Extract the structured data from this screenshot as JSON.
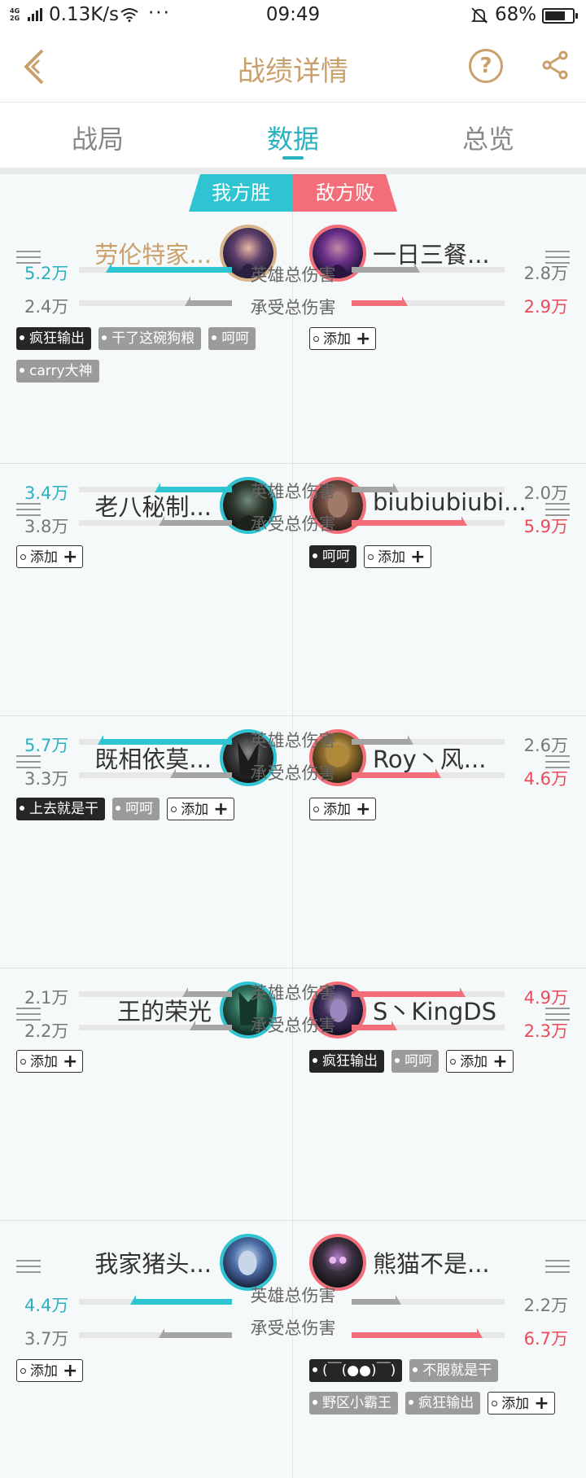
{
  "status": {
    "net": "4G\n2G",
    "speed": "0.13K/s",
    "dots": "···",
    "time": "09:49",
    "battery": "68%"
  },
  "header": {
    "title": "战绩详情",
    "help": "?"
  },
  "tabs": [
    {
      "label": "战局"
    },
    {
      "label": "数据"
    },
    {
      "label": "总览"
    }
  ],
  "result": {
    "us": "我方胜",
    "them": "敌方败"
  },
  "stat_labels": {
    "hero_damage": "英雄总伤害",
    "damage_taken": "承受总伤害"
  },
  "add_label": "添加",
  "rows": [
    {
      "left": {
        "name": "劳伦特家...",
        "hero_damage": "5.2万",
        "damage_taken": "2.4万",
        "tags": [
          "疯狂输出",
          "干了这碗狗粮",
          "呵呵",
          "carry大神"
        ]
      },
      "right": {
        "name": "一日三餐...",
        "hero_damage": "2.8万",
        "damage_taken": "2.9万",
        "tags": []
      }
    },
    {
      "left": {
        "name": "老八秘制...",
        "hero_damage": "3.4万",
        "damage_taken": "3.8万",
        "tags": []
      },
      "right": {
        "name": "biubiubiubi...",
        "hero_damage": "2.0万",
        "damage_taken": "5.9万",
        "tags": [
          "呵呵"
        ]
      }
    },
    {
      "left": {
        "name": "既相依莫...",
        "hero_damage": "5.7万",
        "damage_taken": "3.3万",
        "tags": [
          "上去就是干",
          "呵呵"
        ]
      },
      "right": {
        "name": "Roy丶风...",
        "hero_damage": "2.6万",
        "damage_taken": "4.6万",
        "tags": []
      }
    },
    {
      "left": {
        "name": "王的荣光",
        "hero_damage": "2.1万",
        "damage_taken": "2.2万",
        "tags": []
      },
      "right": {
        "name": "S丶KingDS",
        "hero_damage": "4.9万",
        "damage_taken": "2.3万",
        "tags": [
          "疯狂输出",
          "呵呵"
        ]
      }
    },
    {
      "left": {
        "name": "我家猪头...",
        "hero_damage": "4.4万",
        "damage_taken": "3.7万",
        "tags": []
      },
      "right": {
        "name": "熊猫不是...",
        "hero_damage": "2.2万",
        "damage_taken": "6.7万",
        "tags": [
          "(￣(●●)￣)",
          "不服就是干",
          "野区小霸王",
          "疯狂输出"
        ]
      }
    }
  ],
  "bar_fill": [
    {
      "l_hd": 0.8,
      "l_dt": 0.28,
      "r_hd": 0.42,
      "r_dt": 0.34
    },
    {
      "l_hd": 0.48,
      "l_dt": 0.45,
      "r_hd": 0.28,
      "r_dt": 0.73
    },
    {
      "l_hd": 0.85,
      "l_dt": 0.38,
      "r_hd": 0.38,
      "r_dt": 0.56
    },
    {
      "l_hd": 0.3,
      "l_dt": 0.25,
      "r_hd": 0.72,
      "r_dt": 0.27
    },
    {
      "l_hd": 0.64,
      "l_dt": 0.45,
      "r_hd": 0.3,
      "r_dt": 0.83
    }
  ],
  "colors": {
    "accent": "#2ab0bf",
    "gold": "#c9a06c",
    "win": "#2ec4d2",
    "lose": "#f46e7a"
  }
}
